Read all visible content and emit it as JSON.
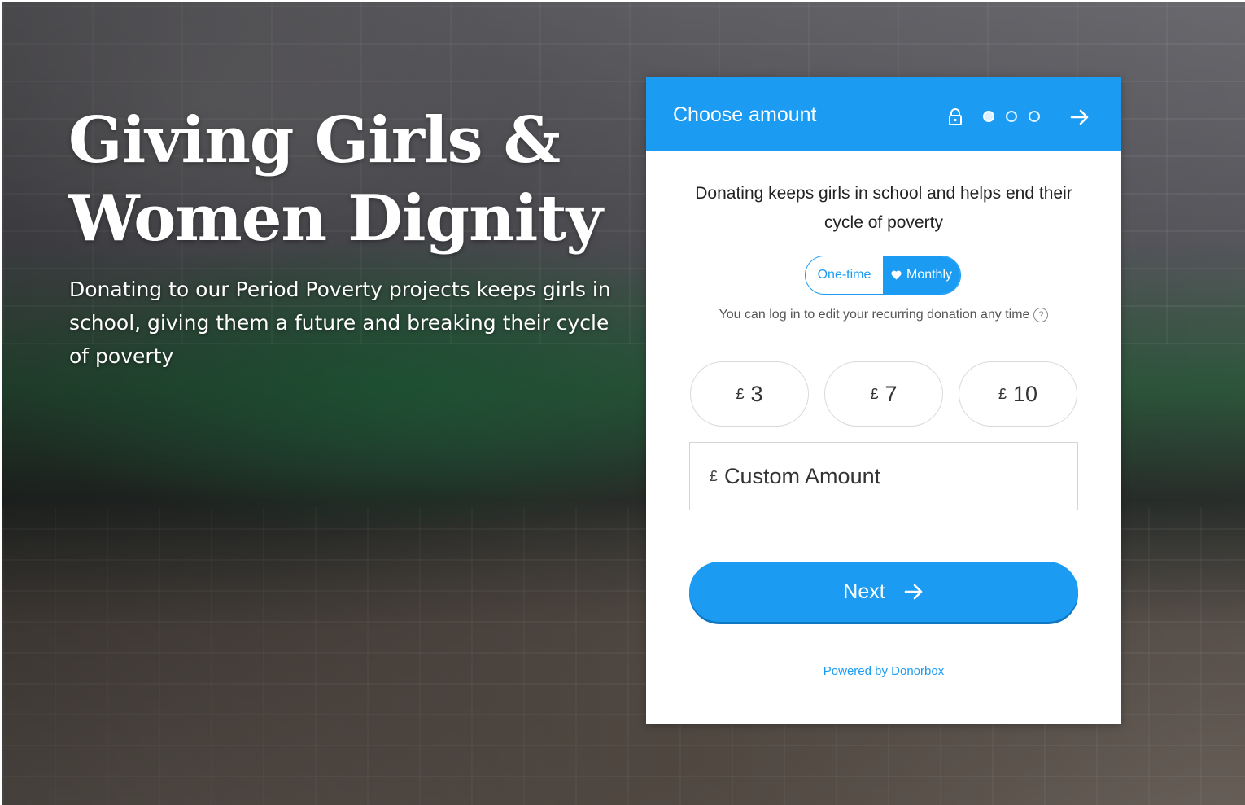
{
  "hero": {
    "title": "Giving Girls & Women Dignity",
    "subtitle": "Donating to our Period Poverty projects keeps girls in school, giving them a future and breaking their cycle of poverty"
  },
  "widget": {
    "header": {
      "title": "Choose amount",
      "icons": [
        "lock-icon",
        "arrow-right-icon"
      ],
      "steps_total": 3,
      "step_active": 1
    },
    "description": "Donating keeps girls in school and helps end their cycle of poverty",
    "frequency": {
      "one_time_label": "One-time",
      "monthly_label": "Monthly",
      "selected": "Monthly"
    },
    "note": "You can log in to edit your recurring donation any time",
    "currency_symbol": "£",
    "amounts": [
      "3",
      "7",
      "10"
    ],
    "custom_amount_placeholder": "Custom Amount",
    "next_label": "Next",
    "powered_by": "Powered by Donorbox",
    "colors": {
      "accent": "#1b9cf2",
      "text": "#222222"
    }
  }
}
